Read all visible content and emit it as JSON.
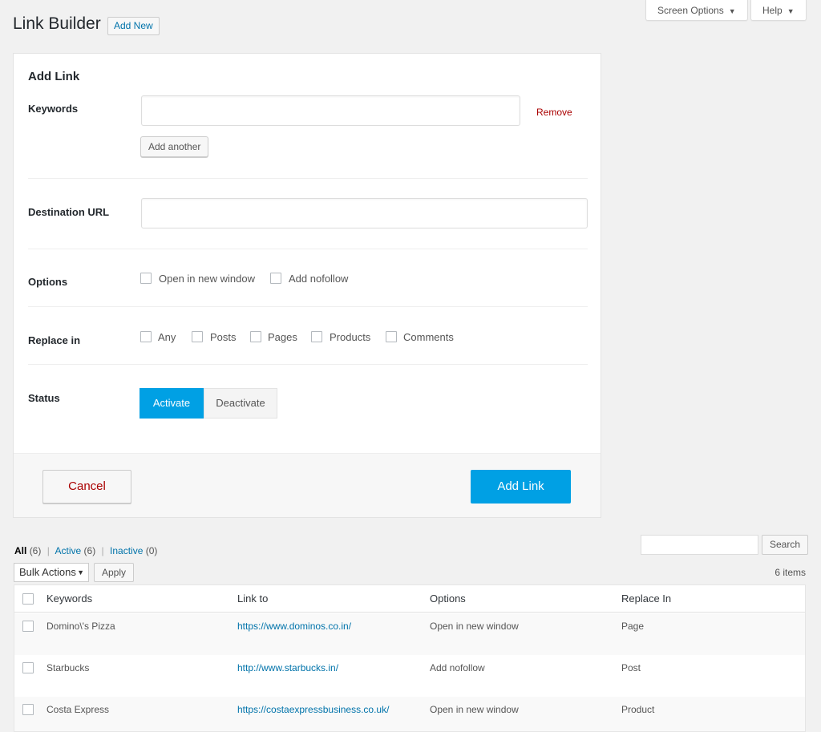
{
  "page": {
    "title": "Link Builder",
    "add_new_label": "Add New"
  },
  "screen_meta": {
    "screen_options_label": "Screen Options",
    "help_label": "Help"
  },
  "form": {
    "heading": "Add Link",
    "keywords_label": "Keywords",
    "keywords_value": "",
    "remove_label": "Remove",
    "add_another_label": "Add another",
    "destination_label": "Destination URL",
    "destination_value": "",
    "options_label": "Options",
    "options": [
      {
        "label": "Open in new window",
        "checked": false
      },
      {
        "label": "Add nofollow",
        "checked": false
      }
    ],
    "replace_label": "Replace in",
    "replace_options": [
      {
        "label": "Any",
        "checked": false
      },
      {
        "label": "Posts",
        "checked": false
      },
      {
        "label": "Pages",
        "checked": false
      },
      {
        "label": "Products",
        "checked": false
      },
      {
        "label": "Comments",
        "checked": false
      }
    ],
    "status_label": "Status",
    "status_activate": "Activate",
    "status_deactivate": "Deactivate",
    "status_selected": "Activate",
    "cancel_label": "Cancel",
    "submit_label": "Add Link"
  },
  "list": {
    "filters": {
      "all_label": "All",
      "all_count": "(6)",
      "active_label": "Active",
      "active_count": "(6)",
      "inactive_label": "Inactive",
      "inactive_count": "(0)"
    },
    "search_button": "Search",
    "search_value": "",
    "bulk_actions_label": "Bulk Actions",
    "apply_label": "Apply",
    "items_count": "6 items",
    "columns": [
      "Keywords",
      "Link to",
      "Options",
      "Replace In"
    ],
    "rows": [
      {
        "keyword": "Domino\\'s Pizza",
        "link": "https://www.dominos.co.in/",
        "options": "Open in new window",
        "replace_in": "Page"
      },
      {
        "keyword": "Starbucks",
        "link": "http://www.starbucks.in/",
        "options": "Add nofollow",
        "replace_in": "Post"
      },
      {
        "keyword": "Costa Express",
        "link": "https://costaexpressbusiness.co.uk/",
        "options": "Open in new window",
        "replace_in": "Product"
      }
    ]
  },
  "colors": {
    "primary": "#00a0e4",
    "link": "#0073aa",
    "danger": "#aa0000",
    "background": "#f1f1f1"
  }
}
